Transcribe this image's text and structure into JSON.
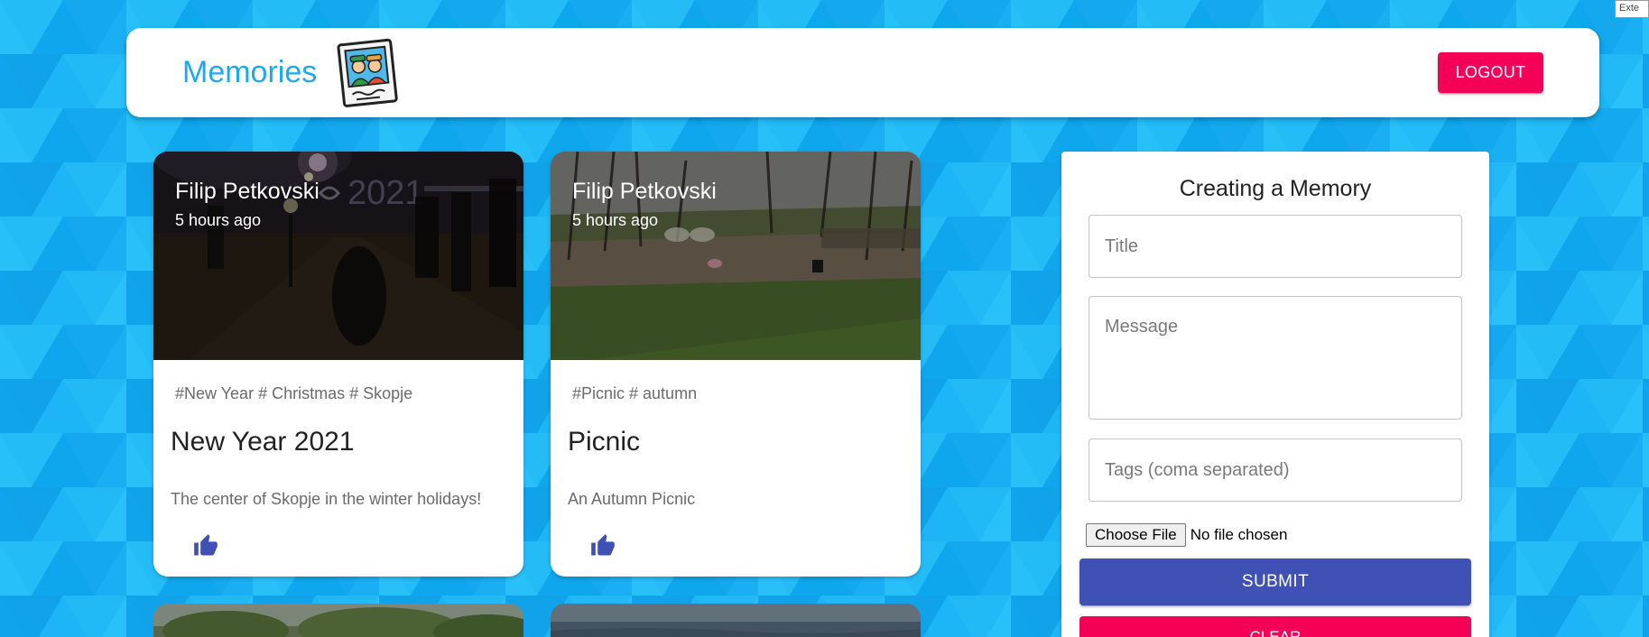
{
  "app": {
    "brand": "Memories",
    "logout_label": "LOGOUT",
    "extension_badge": "Exte"
  },
  "colors": {
    "background": "#1bb3f5",
    "brand_text": "#1ea8f0",
    "secondary": "#f50057",
    "primary": "#3f51b5"
  },
  "icons": {
    "logo": "memories-photo-logo",
    "like": "thumb-up-icon"
  },
  "posts": [
    {
      "author": "Filip Petkovski",
      "time": "5 hours ago",
      "tags": "#New Year # Christmas # Skopje",
      "title": "New Year 2021",
      "message": "The center of Skopje in the winter holidays!"
    },
    {
      "author": "Filip Petkovski",
      "time": "5 hours ago",
      "tags": "#Picnic # autumn",
      "title": "Picnic",
      "message": "An Autumn Picnic"
    }
  ],
  "form": {
    "heading": "Creating a Memory",
    "title_placeholder": "Title",
    "message_placeholder": "Message",
    "tags_placeholder": "Tags (coma separated)",
    "file_button": "Choose File",
    "file_status": "No file chosen",
    "submit_label": "SUBMIT",
    "clear_label": "CLEAR"
  }
}
